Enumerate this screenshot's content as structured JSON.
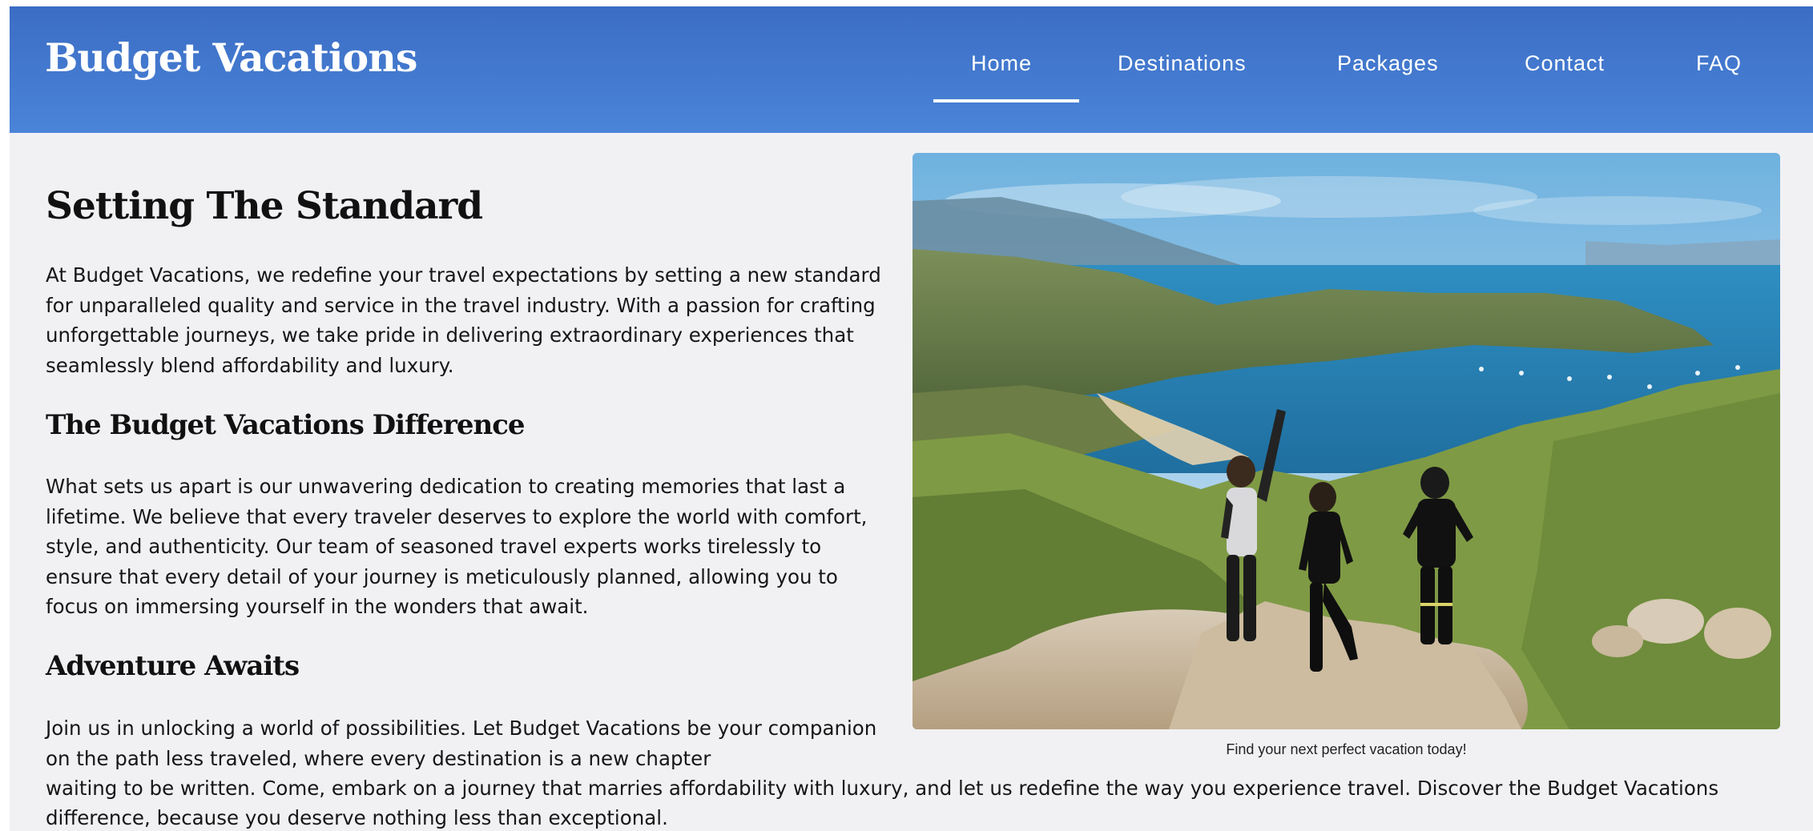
{
  "brand": {
    "name": "Budget Vacations"
  },
  "nav": {
    "items": [
      {
        "label": "Home"
      },
      {
        "label": "Destinations"
      },
      {
        "label": "Packages"
      },
      {
        "label": "Contact"
      },
      {
        "label": "FAQ"
      }
    ],
    "active": "Home"
  },
  "main": {
    "heading": "Setting The Standard",
    "intro": "At Budget Vacations, we redefine your travel expectations by setting a new standard for unparalleled quality and service in the travel industry. With a passion for crafting unforgettable journeys, we take pride in delivering extraordinary experiences that seamlessly blend affordability and luxury.",
    "difference_heading": "The Budget Vacations Difference",
    "difference_text": "What sets us apart is our unwavering dedication to creating memories that last a lifetime. We believe that every traveler deserves to explore the world with comfort, style, and authenticity. Our team of seasoned travel experts works tirelessly to ensure that every detail of your journey is meticulously planned, allowing you to focus on immersing yourself in the wonders that await.",
    "adventure_heading": "Adventure Awaits",
    "adventure_text_part1": "Join us in unlocking a world of possibilities. Let Budget Vacations be your companion on the path less traveled, where every destination is a new chapter",
    "adventure_text_line3": "waiting to be written. Come, embark on a journey that marries affordability with luxury, and let us redefine the way you experience travel. Discover the Budget Vacations",
    "adventure_text_line4": "difference, because you deserve nothing less than exceptional."
  },
  "figure": {
    "caption": "Find your next perfect vacation today!"
  },
  "colors": {
    "header_start": "#3b6dc4",
    "header_end": "#4a84d8",
    "page_bg": "#f1f1f4"
  }
}
